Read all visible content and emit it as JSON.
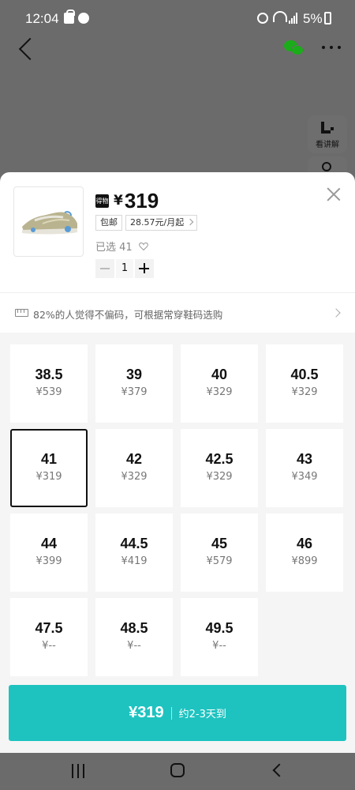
{
  "status_bar": {
    "time": "12:04",
    "battery": "5%"
  },
  "header": {
    "explain_label": "看讲解"
  },
  "product": {
    "badge": "得物",
    "currency": "¥",
    "price": "319",
    "chips": [
      "包邮",
      "28.57元/月起"
    ],
    "selected_label": "已选 41",
    "quantity": "1"
  },
  "fit_tip": "82%的人觉得不偏码，可根据常穿鞋码选购",
  "sizes": [
    {
      "size": "38.5",
      "price": "¥539"
    },
    {
      "size": "39",
      "price": "¥379"
    },
    {
      "size": "40",
      "price": "¥329"
    },
    {
      "size": "40.5",
      "price": "¥329"
    },
    {
      "size": "41",
      "price": "¥319"
    },
    {
      "size": "42",
      "price": "¥329"
    },
    {
      "size": "42.5",
      "price": "¥329"
    },
    {
      "size": "43",
      "price": "¥349"
    },
    {
      "size": "44",
      "price": "¥399"
    },
    {
      "size": "44.5",
      "price": "¥419"
    },
    {
      "size": "45",
      "price": "¥579"
    },
    {
      "size": "46",
      "price": "¥899"
    },
    {
      "size": "47.5",
      "price": "¥--"
    },
    {
      "size": "48.5",
      "price": "¥--"
    },
    {
      "size": "49.5",
      "price": "¥--"
    }
  ],
  "selected_size": "41",
  "buy_button": {
    "price": "¥319",
    "delivery": "约2-3天到"
  },
  "colors": {
    "accent": "#1ec3c0",
    "overlay": "#6b6b6b",
    "wechat": "#1aad19"
  }
}
